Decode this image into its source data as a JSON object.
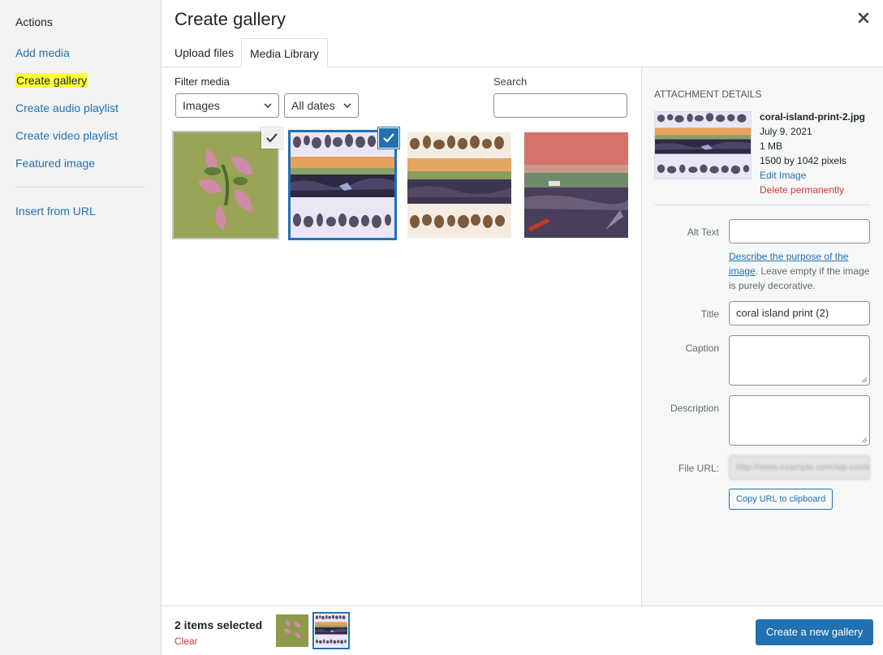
{
  "menu": {
    "heading": "Actions",
    "items": [
      {
        "label": "Add media"
      },
      {
        "label": "Create gallery"
      },
      {
        "label": "Create audio playlist"
      },
      {
        "label": "Create video playlist"
      },
      {
        "label": "Featured image"
      },
      {
        "label": "Insert from URL"
      }
    ],
    "highlight_color": "#ffff3b"
  },
  "frame": {
    "title": "Create gallery",
    "close_icon": "close-icon",
    "tabs": [
      {
        "label": "Upload files"
      },
      {
        "label": "Media Library"
      }
    ]
  },
  "filters": {
    "label": "Filter media",
    "type_value": "Images",
    "date_value": "All dates",
    "search_label": "Search",
    "search_value": ""
  },
  "attachments": [
    {
      "subject": "pink-flowers-painting",
      "selected": true,
      "current": false
    },
    {
      "subject": "coral-island-print-2",
      "selected": true,
      "current": true
    },
    {
      "subject": "coral-island-print",
      "selected": false,
      "current": false
    },
    {
      "subject": "coastal-landscape",
      "selected": false,
      "current": false
    }
  ],
  "details": {
    "heading": "Attachment Details",
    "filename": "coral-island-print-2.jpg",
    "date": "July 9, 2021",
    "size": "1 MB",
    "dimensions": "1500 by 1042 pixels",
    "edit_label": "Edit Image",
    "delete_label": "Delete permanently",
    "alt_label": "Alt Text",
    "alt_value": "",
    "alt_help_link": "Describe the purpose of the image",
    "alt_help_rest": ". Leave empty if the image is purely decorative.",
    "title_label": "Title",
    "title_value": "coral island print (2)",
    "caption_label": "Caption",
    "description_label": "Description",
    "url_label": "File URL:",
    "url_value": "http://www.example.com/wp-content",
    "copy_label": "Copy URL to clipboard"
  },
  "toolbar": {
    "selected_count": "2 items selected",
    "clear_label": "Clear",
    "primary_label": "Create a new gallery"
  },
  "colors": {
    "accent": "#2271b1",
    "danger": "#d63638"
  }
}
